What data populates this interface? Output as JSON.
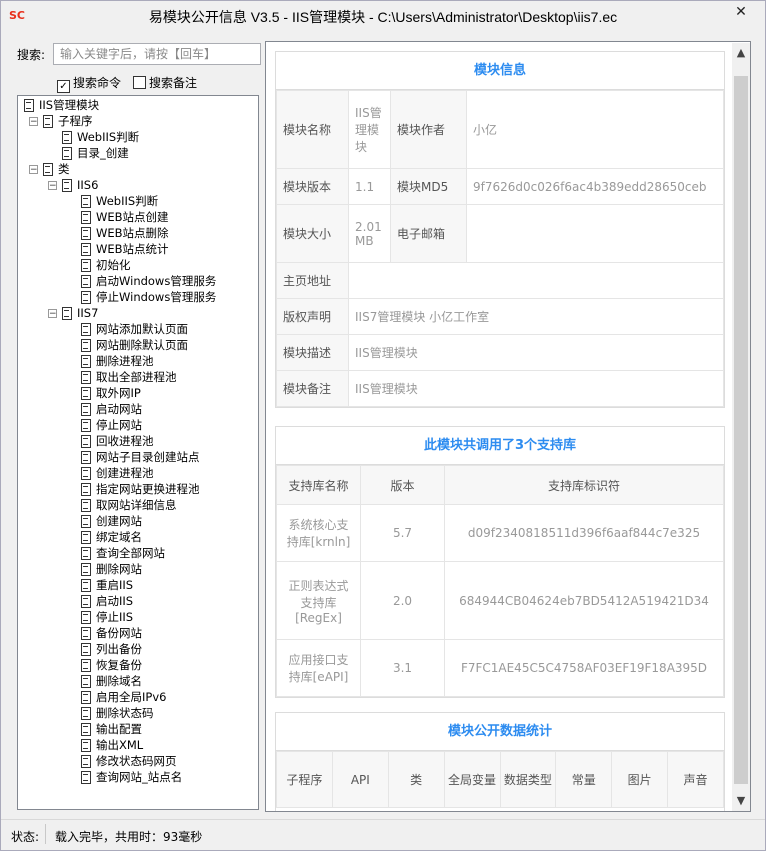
{
  "window": {
    "title": "易模块公开信息 V3.5 - IIS管理模块 - C:\\Users\\Administrator\\Desktop\\iis7.ec",
    "app_icon": "SC",
    "close_glyph": "✕"
  },
  "search": {
    "label": "搜索:",
    "placeholder": "输入关键字后，请按【回车】",
    "value": "",
    "search_commands_label": "搜索命令",
    "search_commands_checked": true,
    "search_notes_label": "搜索备注",
    "search_notes_checked": false
  },
  "tree": {
    "root": "IIS管理模块",
    "subroutines_label": "子程序",
    "subroutines": [
      "WebIIS判断",
      "目录_创建"
    ],
    "classes_label": "类",
    "iis6_label": "IIS6",
    "iis6_items": [
      "WebIIS判断",
      "WEB站点创建",
      "WEB站点删除",
      "WEB站点统计",
      "初始化",
      "启动Windows管理服务",
      "停止Windows管理服务"
    ],
    "iis7_label": "IIS7",
    "iis7_items": [
      "网站添加默认页面",
      "网站删除默认页面",
      "删除进程池",
      "取出全部进程池",
      "取外网IP",
      "启动网站",
      "停止网站",
      "回收进程池",
      "网站子目录创建站点",
      "创建进程池",
      "指定网站更换进程池",
      "取网站详细信息",
      "创建网站",
      "绑定域名",
      "查询全部网站",
      "删除网站",
      "重启IIS",
      "启动IIS",
      "停止IIS",
      "备份网站",
      "列出备份",
      "恢复备份",
      "删除域名",
      "启用全局IPv6",
      "删除状态码",
      "输出配置",
      "输出XML",
      "修改状态码网页",
      "查询网站_站点名"
    ]
  },
  "module_info": {
    "title": "模块信息",
    "name_key": "模块名称",
    "name_val": "IIS管理模块",
    "author_key": "模块作者",
    "author_val": "小亿",
    "version_key": "模块版本",
    "version_val": "1.1",
    "md5_key": "模块MD5",
    "md5_val": "9f7626d0c026f6ac4b389edd28650ceb",
    "size_key": "模块大小",
    "size_val": "2.01 MB",
    "email_key": "电子邮箱",
    "email_val": "",
    "home_key": "主页地址",
    "home_val": "",
    "copyright_key": "版权声明",
    "copyright_val": "IIS7管理模块 小亿工作室",
    "desc_key": "模块描述",
    "desc_val": "IIS管理模块",
    "note_key": "模块备注",
    "note_val": "IIS管理模块"
  },
  "libs": {
    "title": "此模块共调用了3个支持库",
    "headers": [
      "支持库名称",
      "版本",
      "支持库标识符"
    ],
    "rows": [
      [
        "系统核心支持库[krnln]",
        "5.7",
        "d09f2340818511d396f6aaf844c7e325"
      ],
      [
        "正则表达式支持库[RegEx]",
        "2.0",
        "684944CB04624eb7BD5412A519421D34"
      ],
      [
        "应用接口支持库[eAPI]",
        "3.1",
        "F7FC1AE45C5C4758AF03EF19F18A395D"
      ]
    ]
  },
  "stats": {
    "title": "模块公开数据统计",
    "headers": [
      "子程序",
      "API",
      "类",
      "全局变量",
      "数据类型",
      "常量",
      "图片",
      "声音"
    ]
  },
  "scrollbar": {
    "up": "▲",
    "down": "▼"
  },
  "status": {
    "label": "状态:",
    "text": "载入完毕，共用时：93毫秒"
  }
}
